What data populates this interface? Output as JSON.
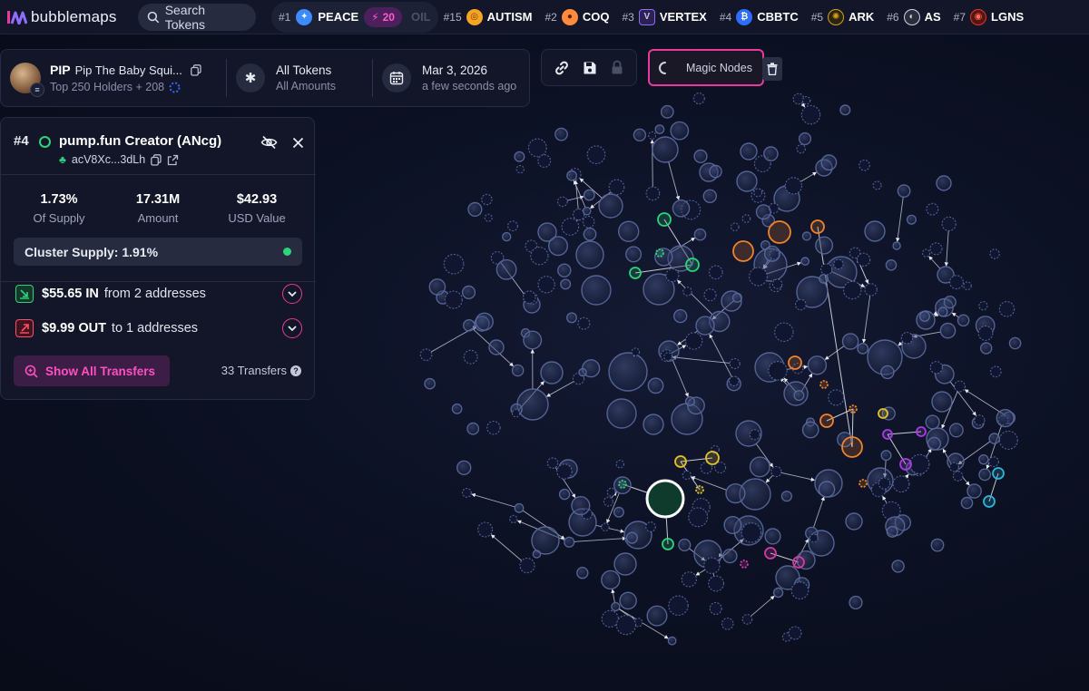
{
  "app": {
    "name": "bubblemaps"
  },
  "search": {
    "label": "Search Tokens"
  },
  "trending": [
    {
      "rank": "#1",
      "symbol": "PEACE",
      "boost": "20",
      "icon_color": "#3d8bff"
    },
    {
      "faded": "OIL"
    },
    {
      "rank": "#15",
      "symbol": "AUTISM",
      "icon_color": "#f5a524"
    },
    {
      "rank": "#2",
      "symbol": "COQ",
      "icon_color": "#ff8a3d"
    },
    {
      "rank": "#3",
      "symbol": "VERTEX",
      "icon_color": "#8d6cff"
    },
    {
      "rank": "#4",
      "symbol": "CBBTC",
      "icon_color": "#2d6cff"
    },
    {
      "rank": "#5",
      "symbol": "ARK",
      "icon_color": "#d4a017"
    },
    {
      "rank": "#6",
      "symbol": "AS",
      "icon_color": "#cfd3e3"
    },
    {
      "rank": "#7",
      "symbol": "LGNS",
      "icon_color": "#e0352b"
    }
  ],
  "token": {
    "symbol": "PIP",
    "name": "Pip The Baby Squi...",
    "holders": "Top 250 Holders + 208"
  },
  "filter": {
    "title": "All Tokens",
    "sub": "All Amounts"
  },
  "date": {
    "title": "Mar 3, 2026",
    "sub": "a few seconds ago"
  },
  "magic_nodes": {
    "label": "Magic Nodes"
  },
  "details": {
    "rank": "#4",
    "name": "pump.fun Creator (ANcg)",
    "address": "acV8Xc...3dLh",
    "stats": [
      {
        "value": "1.73%",
        "label": "Of Supply"
      },
      {
        "value": "17.31M",
        "label": "Amount"
      },
      {
        "value": "$42.93",
        "label": "USD Value"
      }
    ],
    "cluster_supply": "Cluster Supply: 1.91%",
    "inflow": {
      "amount": "$55.65 IN",
      "text": "from 2 addresses"
    },
    "outflow": {
      "amount": "$9.99 OUT",
      "text": "to 1 addresses"
    },
    "transfers_button": "Show All Transfers",
    "transfers_count": "33 Transfers"
  },
  "colors": {
    "accent_pink": "#e9399d",
    "green": "#2ed47a",
    "orange": "#f0832c",
    "purple": "#a43ee0",
    "cyan": "#2bb6d9",
    "yellow": "#e3c22d",
    "magenta": "#d23aa4",
    "bubble_stroke": "#5b6a9e"
  }
}
